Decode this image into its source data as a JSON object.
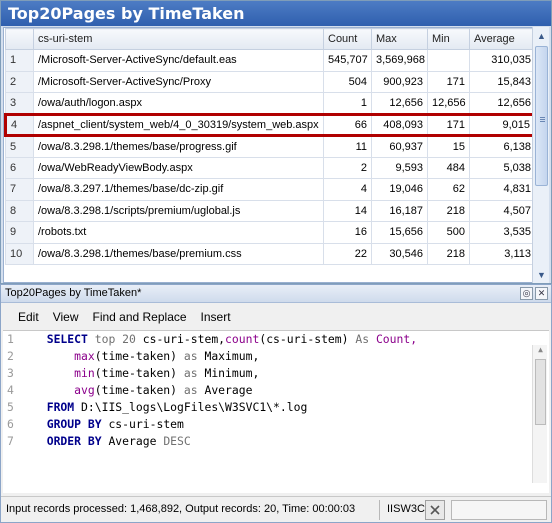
{
  "results": {
    "title": "Top20Pages by TimeTaken",
    "columns": [
      "",
      "cs-uri-stem",
      "Count",
      "Max",
      "Min",
      "Average"
    ],
    "rows": [
      {
        "n": "1",
        "uri": "/Microsoft-Server-ActiveSync/default.eas",
        "count": "545,707",
        "max": "3,569,968",
        "min": "",
        "avg": "310,035"
      },
      {
        "n": "2",
        "uri": "/Microsoft-Server-ActiveSync/Proxy",
        "count": "504",
        "max": "900,923",
        "min": "171",
        "avg": "15,843"
      },
      {
        "n": "3",
        "uri": "/owa/auth/logon.aspx",
        "count": "1",
        "max": "12,656",
        "min": "12,656",
        "avg": "12,656"
      },
      {
        "n": "4",
        "uri": "/aspnet_client/system_web/4_0_30319/system_web.aspx",
        "count": "66",
        "max": "408,093",
        "min": "171",
        "avg": "9,015"
      },
      {
        "n": "5",
        "uri": "/owa/8.3.298.1/themes/base/progress.gif",
        "count": "11",
        "max": "60,937",
        "min": "15",
        "avg": "6,138"
      },
      {
        "n": "6",
        "uri": "/owa/WebReadyViewBody.aspx",
        "count": "2",
        "max": "9,593",
        "min": "484",
        "avg": "5,038"
      },
      {
        "n": "7",
        "uri": "/owa/8.3.297.1/themes/base/dc-zip.gif",
        "count": "4",
        "max": "19,046",
        "min": "62",
        "avg": "4,831"
      },
      {
        "n": "8",
        "uri": "/owa/8.3.298.1/scripts/premium/uglobal.js",
        "count": "14",
        "max": "16,187",
        "min": "218",
        "avg": "4,507"
      },
      {
        "n": "9",
        "uri": "/robots.txt",
        "count": "16",
        "max": "15,656",
        "min": "500",
        "avg": "3,535"
      },
      {
        "n": "10",
        "uri": "/owa/8.3.298.1/themes/base/premium.css",
        "count": "22",
        "max": "30,546",
        "min": "218",
        "avg": "3,113"
      }
    ],
    "highlighted_row": "4"
  },
  "query": {
    "title": "Top20Pages by TimeTaken*",
    "menu": [
      "Edit",
      "View",
      "Find and Replace",
      "Insert"
    ],
    "line_numbers": [
      "1",
      "2",
      "3",
      "4",
      "5",
      "6",
      "7"
    ],
    "sql": {
      "l1_select": "SELECT",
      "l1_top": "top 20",
      "l1_field": "cs-uri-stem,",
      "l1_count": "count",
      "l1_paren": "(cs-uri-stem)",
      "l1_as": "As",
      "l1_alias": "Count,",
      "l2_fn": "max",
      "l2_arg": "(time-taken)",
      "l2_as": "as",
      "l2_alias": "Maximum,",
      "l3_fn": "min",
      "l3_arg": "(time-taken)",
      "l3_as": "as",
      "l3_alias": "Minimum,",
      "l4_fn": "avg",
      "l4_arg": "(time-taken)",
      "l4_as": "as",
      "l4_alias": "Average",
      "l5_from": "FROM",
      "l5_path": "D:\\IIS_logs\\LogFiles\\W3SVC1\\*.log",
      "l6_group": "GROUP BY",
      "l6_field": "cs-uri-stem",
      "l7_order": "ORDER BY",
      "l7_field": "Average",
      "l7_desc": "DESC"
    }
  },
  "status": {
    "message": "Input records processed: 1,468,892, Output records: 20, Time: 00:00:03",
    "format": "IISW3C"
  },
  "colors": {
    "title_bar": "#2f5fae",
    "highlight": "#b00000",
    "keyword": "#00008b",
    "function": "#8b008b"
  }
}
